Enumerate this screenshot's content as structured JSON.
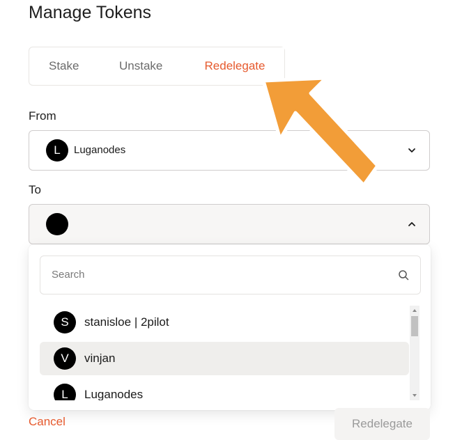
{
  "title": "Manage Tokens",
  "tabs": [
    {
      "label": "Stake",
      "active": false
    },
    {
      "label": "Unstake",
      "active": false
    },
    {
      "label": "Redelegate",
      "active": true
    }
  ],
  "from": {
    "label": "From",
    "selected": {
      "initial": "L",
      "name": "Luganodes"
    }
  },
  "to": {
    "label": "To",
    "selected": {
      "initial": "",
      "name": ""
    }
  },
  "dropdown": {
    "search_placeholder": "Search",
    "items": [
      {
        "initial": "S",
        "name": "stanisloe | 2pilot"
      },
      {
        "initial": "V",
        "name": "vinjan"
      },
      {
        "initial": "L",
        "name": "Luganodes"
      }
    ]
  },
  "footer": {
    "cancel_label": "Cancel",
    "submit_label": "Redelegate"
  },
  "colors": {
    "accent": "#e65a2e",
    "annotation_arrow": "#f29d38"
  },
  "icons": {
    "from_chevron": "chevron-down-icon",
    "to_chevron": "chevron-up-icon",
    "search": "search-icon",
    "annotation": "arrow-annotation-icon"
  }
}
